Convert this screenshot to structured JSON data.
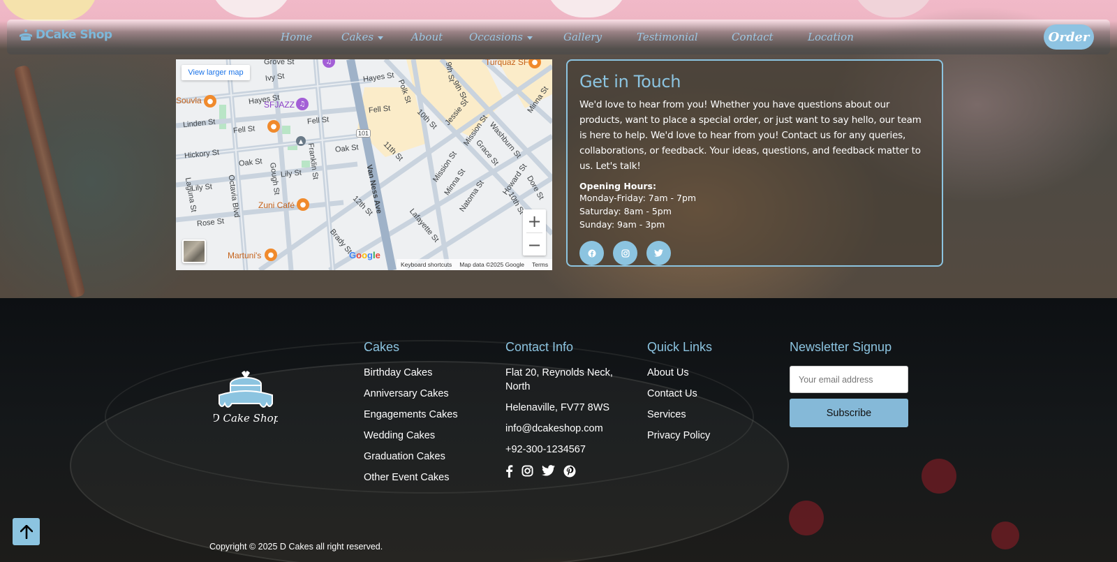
{
  "nav": {
    "brand": "DCake Shop",
    "links": [
      {
        "label": "Home"
      },
      {
        "label": "Cakes"
      },
      {
        "label": "About"
      },
      {
        "label": "Occasions"
      },
      {
        "label": "Gallery"
      },
      {
        "label": "Testimonial"
      },
      {
        "label": "Contact"
      },
      {
        "label": "Location"
      }
    ],
    "order": "Order"
  },
  "map": {
    "view_larger": "View larger map",
    "labels": {
      "grove": "Grove St",
      "ivy": "Ivy St",
      "hayes_l": "Hayes St",
      "hayes_r": "Hayes St",
      "souvla": "Souvla",
      "sfjazz": "SFJAZZ",
      "linden": "Linden St",
      "fell_l": "Fell St",
      "fell_m": "Fell St",
      "fell_r": "Fell St",
      "hickory": "Hickory St",
      "oak_l": "Oak St",
      "oak_r": "Oak St",
      "lily_l": "Lily St",
      "lily_m": "Lily St",
      "laguna": "Laguna St",
      "octavia": "Octavia Blvd",
      "gough": "Gough St",
      "franklin": "Franklin St",
      "zuni": "Zuni Café",
      "rose": "Rose St",
      "martunis": "Martuni's",
      "turquaz": "Turquaz SF",
      "polk": "Polk St",
      "ninth_a": "9th St",
      "ninth_b": "9th St",
      "tenth_a": "10th St",
      "tenth_b": "10th St",
      "eleventh": "11th St",
      "twelfth": "12th St",
      "jessie": "Jessie St",
      "mission_a": "Mission St",
      "mission_b": "Mission St",
      "minna_a": "Minna St",
      "minna_b": "Minna St",
      "grace": "Grace St",
      "washburn": "Washburn St",
      "natoma": "Natoma St",
      "howard": "Howard St",
      "dore": "Dore St",
      "vanness": "Van Ness Ave",
      "brady": "Brady St",
      "lafayette": "Lafayette St",
      "hwy": "101"
    },
    "footer": {
      "shortcuts": "Keyboard shortcuts",
      "data": "Map data ©2025 Google",
      "terms": "Terms"
    },
    "google": "Google"
  },
  "contact": {
    "title": "Get in Touch",
    "description": "We'd love to hear from you! Whether you have questions about our products, want to place a special order, or just want to say hello, our team is here to help. We'd love to hear from you! Contact us for any queries, collaborations, or feedback. Your ideas, questions, and feedback matter to us. Let's talk!",
    "hours_title": "Opening Hours:",
    "hours": [
      "Monday-Friday: 7am - 7pm",
      "Saturday: 8am - 5pm",
      "Sunday: 9am - 3pm"
    ],
    "socials": [
      "facebook-icon",
      "instagram-icon",
      "twitter-icon"
    ]
  },
  "footer": {
    "logo_text": "D Cake Shop",
    "cakes": {
      "title": "Cakes",
      "items": [
        "Birthday Cakes",
        "Anniversary Cakes",
        "Engagements Cakes",
        "Wedding Cakes",
        "Graduation Cakes",
        "Other Event Cakes"
      ]
    },
    "contact": {
      "title": "Contact Info",
      "address1": "Flat 20, Reynolds Neck, North",
      "address2": "Helenaville, FV77 8WS",
      "email": "info@dcakeshop.com",
      "phone": "+92-300-1234567",
      "icons": [
        "facebook-icon",
        "instagram-icon",
        "twitter-icon",
        "pinterest-icon"
      ]
    },
    "quick": {
      "title": "Quick Links",
      "items": [
        "About Us",
        "Contact Us",
        "Services",
        "Privacy Policy"
      ]
    },
    "newsletter": {
      "title": "Newsletter Signup",
      "placeholder": "Your email address",
      "button": "Subscribe"
    },
    "copyright": "Copyright © 2025 D Cakes all right reserved."
  },
  "colors": {
    "accent": "#8cc4e0",
    "subscribe": "#85b9d8"
  }
}
